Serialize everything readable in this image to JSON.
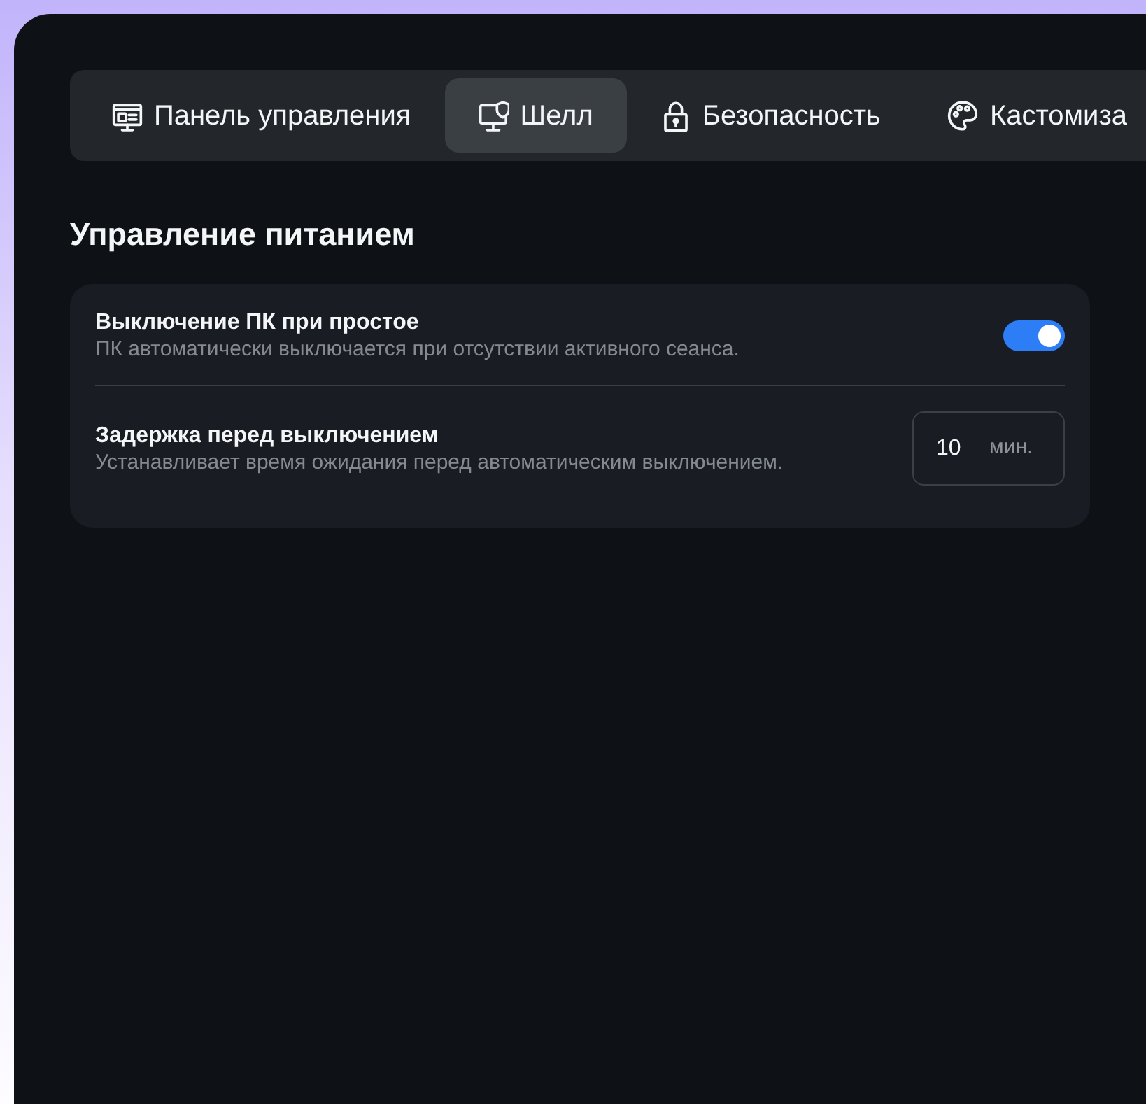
{
  "tabs": [
    {
      "label": "Панель управления",
      "selected": false
    },
    {
      "label": "Шелл",
      "selected": true
    },
    {
      "label": "Безопасность",
      "selected": false
    },
    {
      "label": "Кастомиза",
      "selected": false
    }
  ],
  "section": {
    "title": "Управление питанием",
    "settings": [
      {
        "kind": "toggle",
        "title": "Выключение ПК при простое",
        "description": "ПК автоматически выключается при отсутствии активного сеанса.",
        "on": true
      },
      {
        "kind": "number",
        "title": "Задержка перед выключением",
        "description": "Устанавливает время ожидания перед автоматическим выключением.",
        "value": "10",
        "unit": "мин."
      }
    ]
  }
}
